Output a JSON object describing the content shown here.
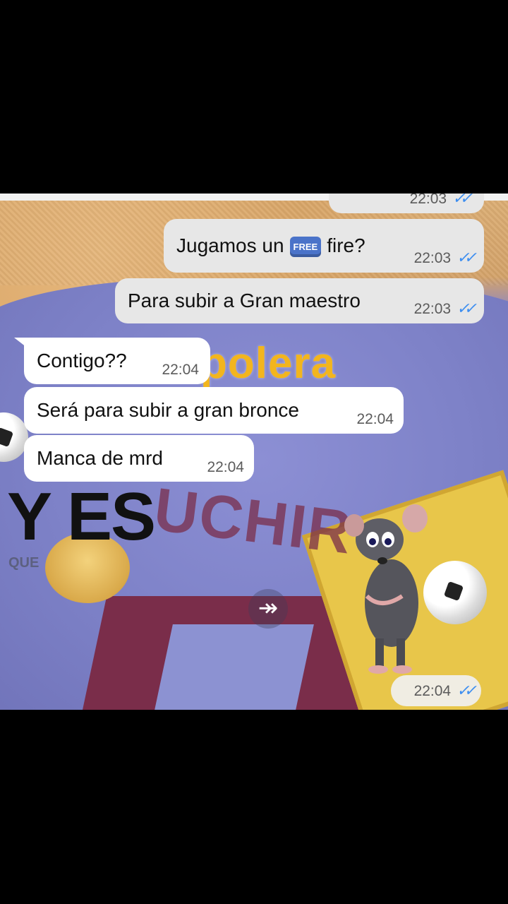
{
  "chat": {
    "partial_top_time": "22:03",
    "messages": [
      {
        "dir": "out",
        "text_before": "Jugamos un",
        "emoji": "FREE",
        "text_after": "fire?",
        "time": "22:03"
      },
      {
        "dir": "out",
        "text": "Para subir a Gran maestro",
        "time": "22:03"
      },
      {
        "dir": "in",
        "text": "Contigo??",
        "time": "22:04"
      },
      {
        "dir": "in",
        "text": "Será para subir a gran bronce",
        "time": "22:04"
      },
      {
        "dir": "in",
        "text": "Manca de mrd",
        "time": "22:04"
      }
    ],
    "sticker_time": "22:04"
  },
  "overlay": {
    "polera": "polera",
    "shirt_name": "UCHIR",
    "yes": "Y ES",
    "que": "QUE"
  },
  "colors": {
    "outgoing_bubble": "#e7e7e7",
    "incoming_bubble": "#ffffff",
    "read_ticks": "#3d8ef0",
    "polera_text": "#f2b51e"
  },
  "icons": [
    "double-check-icon",
    "forward-icon",
    "free-emoji-icon"
  ]
}
